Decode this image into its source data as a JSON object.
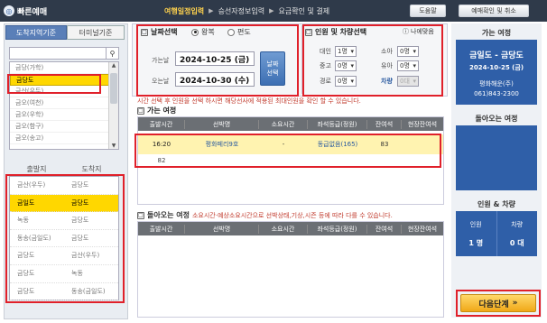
{
  "header": {
    "logo": "빠른예매",
    "steps": [
      "여행일정입력",
      "승선자정보입력",
      "요금확인 및 결제"
    ],
    "active_step": 0,
    "help_button": "도움말",
    "confirm_button": "예매확인 및 취소"
  },
  "left": {
    "tabs": [
      "도착지역기준",
      "터미널기준"
    ],
    "search_placeholder": "",
    "regions": [
      "금당(가학)",
      "금당도",
      "금산(우두)",
      "금오(여천)",
      "금오(우학)",
      "금오(함구)",
      "금오(송고)"
    ],
    "selected_region": 1,
    "od_headers": [
      "출발지",
      "도착지"
    ],
    "od_rows": [
      [
        "금산(우두)",
        "금당도"
      ],
      [
        "금일도",
        "금당도"
      ],
      [
        "녹동",
        "금당도"
      ],
      [
        "동송(금일도)",
        "금당도"
      ],
      [
        "금당도",
        "금산(우두)"
      ],
      [
        "금당도",
        "녹동"
      ],
      [
        "금당도",
        "동송(금일도)"
      ]
    ],
    "selected_od": 1
  },
  "date_box": {
    "title": "날짜선택",
    "round_trip": "왕복",
    "one_way": "편도",
    "go_label": "가는날",
    "go_date": "2024-10-25 (금)",
    "return_label": "오는날",
    "return_date": "2024-10-30 (수)",
    "select_button": [
      "날짜",
      "선택"
    ]
  },
  "pax_box": {
    "title": "인원 및 차량선택",
    "help": "나에맞음",
    "labels": [
      "대인",
      "중고",
      "경로",
      "소아",
      "유아",
      "차량"
    ],
    "values": [
      "1명",
      "0명",
      "0명",
      "0명",
      "0명",
      "0대"
    ],
    "vehicle_label": "차량"
  },
  "notices": {
    "time_notice": "시간 선택 후 인원을 선택 하시면 해당선사에 적용된 최대인원을 확인 할 수 있습니다.",
    "return_notice": "소요시간·예상소요시간으로 선박상태,기상,시즌 등에 따라 다를 수 있습니다."
  },
  "go_table": {
    "title": "가는 여정",
    "headers": [
      "출발시간",
      "선박명",
      "소요시간",
      "좌석등급(정원)",
      "잔여석",
      "현장잔여석"
    ],
    "row": [
      "16:20",
      "평화페리9호",
      "-",
      "동급없음(165)",
      "83",
      ""
    ],
    "extra": "82"
  },
  "return_table": {
    "title": "돌아오는 여정",
    "headers": [
      "출발시간",
      "선박명",
      "소요시간",
      "좌석등급(정원)",
      "잔여석",
      "현장잔여석"
    ]
  },
  "right": {
    "go_title": "가는 여정",
    "route": "금일도 - 금당도",
    "date": "2024-10-25 (금)",
    "company": "평화해운(주)",
    "phone": "061)843-2300",
    "return_title": "돌아오는 여정",
    "pax_title": "인원 & 차량",
    "pax_labels": [
      "인원",
      "차량"
    ],
    "pax_values": [
      "1 명",
      "0 대"
    ],
    "next": "다음단계"
  }
}
